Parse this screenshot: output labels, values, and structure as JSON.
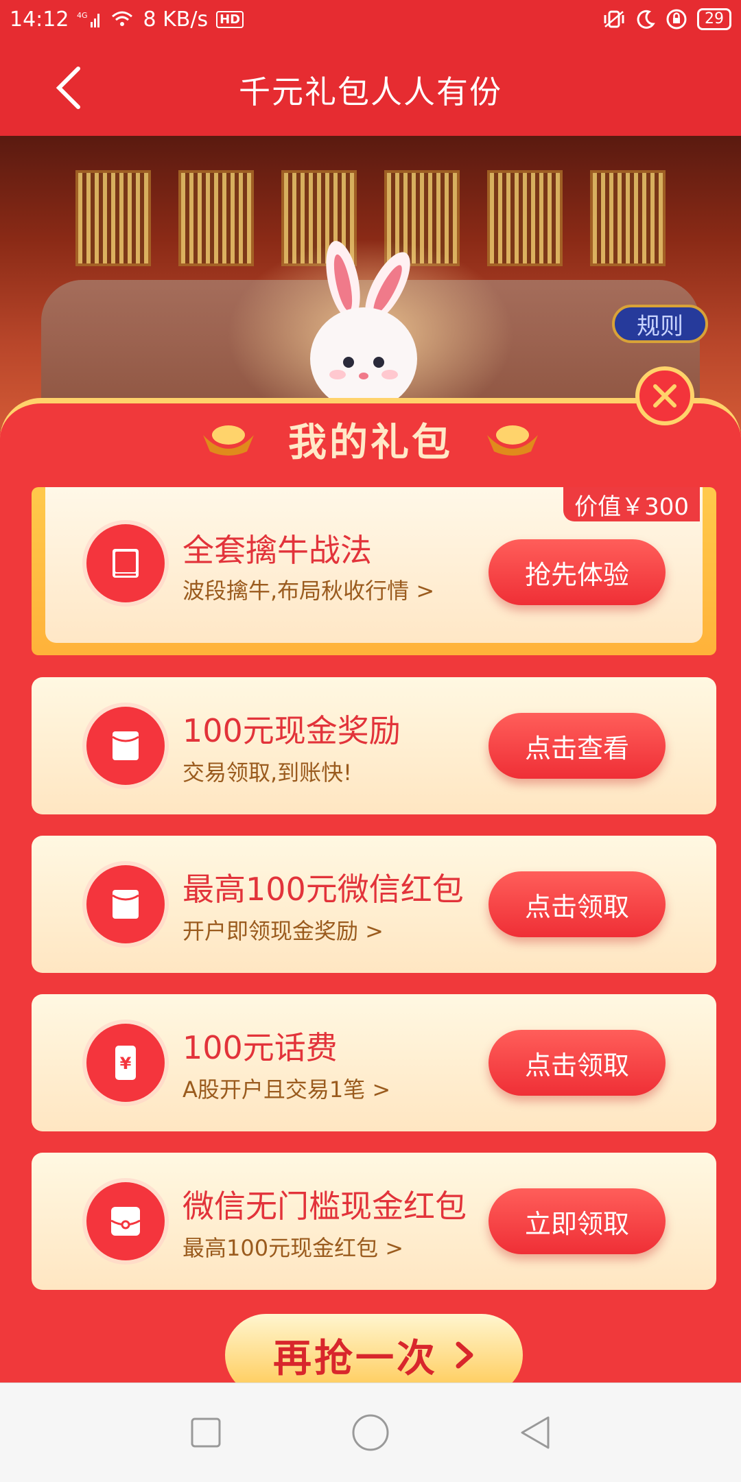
{
  "status_bar": {
    "time": "14:12",
    "network": "4G",
    "speed": "8 KB/s",
    "hd": "HD",
    "battery": "29"
  },
  "nav": {
    "title": "千元礼包人人有份"
  },
  "hero": {
    "rules_label": "规则"
  },
  "panel": {
    "title": "我的礼包",
    "featured": {
      "value_tag": "价值￥300",
      "title": "全套擒牛战法",
      "subtitle": "波段擒牛,布局秋收行情 >",
      "button": "抢先体验",
      "icon": "book-icon"
    },
    "items": [
      {
        "title": "100元现金奖励",
        "subtitle": "交易领取,到账快!",
        "button": "点击查看",
        "icon": "red-envelope-icon"
      },
      {
        "title": "最高100元微信红包",
        "subtitle": "开户即领现金奖励 >",
        "button": "点击领取",
        "icon": "red-envelope-icon"
      },
      {
        "title": "100元话费",
        "subtitle": "A股开户且交易1笔 >",
        "button": "点击领取",
        "icon": "phone-yuan-icon"
      },
      {
        "title": "微信无门槛现金红包",
        "subtitle": "最高100元现金红包 >",
        "button": "立即领取",
        "icon": "wallet-icon"
      }
    ],
    "again_label": "再抢一次"
  },
  "colors": {
    "primary_red": "#e62c31",
    "gold": "#ffd36b",
    "card_bg": "#fff8e2",
    "button_red": "#ef2f36"
  }
}
